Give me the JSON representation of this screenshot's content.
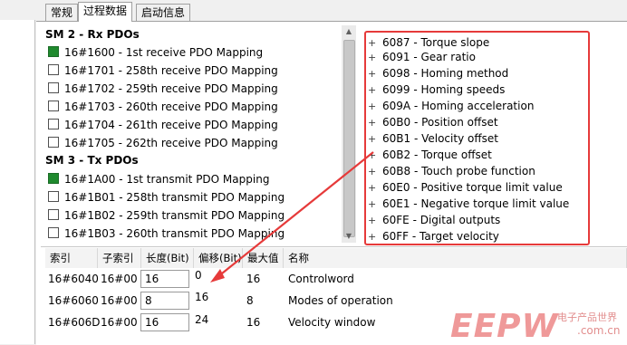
{
  "tabs": [
    {
      "label": "常规"
    },
    {
      "label": "过程数据"
    },
    {
      "label": "启动信息"
    }
  ],
  "sm2": {
    "header": "SM 2 - Rx PDOs",
    "items": [
      {
        "label": "16#1600  -  1st receive PDO Mapping",
        "checked": true
      },
      {
        "label": "16#1701  -  258th receive PDO Mapping",
        "checked": false
      },
      {
        "label": "16#1702  -  259th receive PDO Mapping",
        "checked": false
      },
      {
        "label": "16#1703  -  260th receive PDO Mapping",
        "checked": false
      },
      {
        "label": "16#1704  -  261th receive PDO Mapping",
        "checked": false
      },
      {
        "label": "16#1705  -  262th receive PDO Mapping",
        "checked": false
      }
    ]
  },
  "sm3": {
    "header": "SM 3 - Tx PDOs",
    "items": [
      {
        "label": "16#1A00  -  1st transmit PDO Mapping",
        "checked": true
      },
      {
        "label": "16#1B01  -  258th transmit PDO Mapping",
        "checked": false
      },
      {
        "label": "16#1B02  -  259th transmit PDO Mapping",
        "checked": false
      },
      {
        "label": "16#1B03  -  260th transmit PDO Mapping",
        "checked": false
      }
    ]
  },
  "objects": [
    {
      "label": "6087 - Torque slope"
    },
    {
      "label": "6091 - Gear ratio"
    },
    {
      "label": "6098 - Homing method"
    },
    {
      "label": "6099 - Homing speeds"
    },
    {
      "label": "609A - Homing acceleration"
    },
    {
      "label": "60B0 - Position offset"
    },
    {
      "label": "60B1 - Velocity offset"
    },
    {
      "label": "60B2 - Torque offset"
    },
    {
      "label": "60B8 - Touch probe function"
    },
    {
      "label": "60E0 - Positive torque limit value"
    },
    {
      "label": "60E1 - Negative torque limit value"
    },
    {
      "label": "60FE - Digital outputs"
    },
    {
      "label": "60FF - Target velocity"
    }
  ],
  "table": {
    "columns": [
      "索引",
      "子索引",
      "长度(Bit)",
      "偏移(Bit)",
      "最大值",
      "名称"
    ],
    "rows": [
      {
        "index": "16#6040",
        "subindex": "16#00",
        "length": "16",
        "offset": "0",
        "max": "16",
        "name": "Controlword"
      },
      {
        "index": "16#6060",
        "subindex": "16#00",
        "length": "8",
        "offset": "16",
        "max": "8",
        "name": "Modes of operation"
      },
      {
        "index": "16#606D",
        "subindex": "16#00",
        "length": "16",
        "offset": "24",
        "max": "16",
        "name": "Velocity window"
      }
    ]
  },
  "watermark": {
    "logo": "EEPW",
    "tagline": "电子产品世界",
    "url": ".com.cn"
  },
  "colors": {
    "highlight_box": "#e63a3a",
    "checked": "#1f8a2e"
  }
}
